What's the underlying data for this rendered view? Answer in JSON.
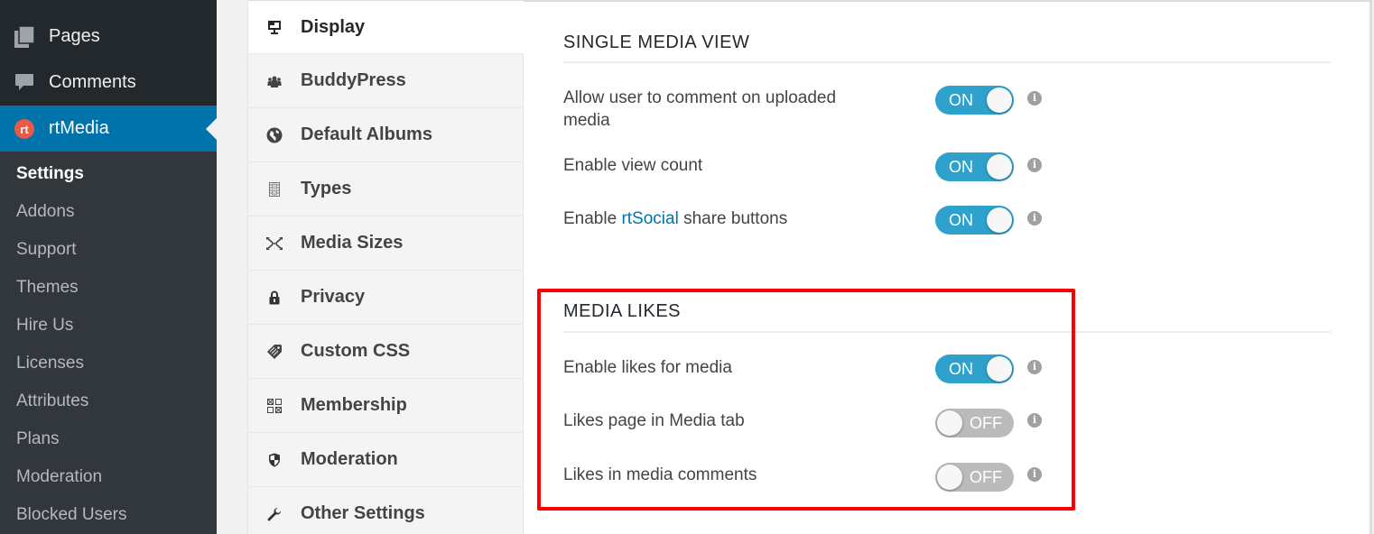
{
  "admin_menu": {
    "items": [
      {
        "label": "Pages",
        "icon": "pages-icon"
      },
      {
        "label": "Comments",
        "icon": "comments-icon"
      },
      {
        "label": "rtMedia",
        "icon": "rtmedia-logo-icon",
        "current": true
      }
    ],
    "submenu": [
      {
        "label": "Settings",
        "current": true
      },
      {
        "label": "Addons"
      },
      {
        "label": "Support"
      },
      {
        "label": "Themes"
      },
      {
        "label": "Hire Us"
      },
      {
        "label": "Licenses"
      },
      {
        "label": "Attributes"
      },
      {
        "label": "Plans"
      },
      {
        "label": "Moderation"
      },
      {
        "label": "Blocked Users"
      }
    ]
  },
  "tabs": [
    {
      "label": "Display",
      "icon": "monitor-icon",
      "active": true
    },
    {
      "label": "BuddyPress",
      "icon": "group-icon"
    },
    {
      "label": "Default Albums",
      "icon": "globe-icon"
    },
    {
      "label": "Types",
      "icon": "film-icon"
    },
    {
      "label": "Media Sizes",
      "icon": "resize-icon"
    },
    {
      "label": "Privacy",
      "icon": "lock-icon"
    },
    {
      "label": "Custom CSS",
      "icon": "tag-icon"
    },
    {
      "label": "Membership",
      "icon": "grid-icon"
    },
    {
      "label": "Moderation",
      "icon": "shield-icon"
    },
    {
      "label": "Other Settings",
      "icon": "wrench-icon"
    }
  ],
  "sections": [
    {
      "title": "SINGLE MEDIA VIEW",
      "rows": [
        {
          "label": "Allow user to comment on uploaded media",
          "state": "ON"
        },
        {
          "label_prefix": "Enable ",
          "link": "rtSocial",
          "label_suffix": " share buttons",
          "state": "ON"
        },
        {
          "label": "Enable view count",
          "state": "ON"
        }
      ]
    },
    {
      "title": "MEDIA LIKES",
      "rows": [
        {
          "label": "Enable likes for media",
          "state": "ON"
        },
        {
          "label": "Likes page in Media tab",
          "state": "OFF"
        },
        {
          "label": "Likes in media comments",
          "state": "OFF"
        }
      ]
    }
  ],
  "info_glyph": "i",
  "colors": {
    "toggle_on": "#2ea2cc",
    "toggle_off": "#bbbbbb",
    "admin_current": "#0073aa",
    "highlight": "#ff0000"
  }
}
